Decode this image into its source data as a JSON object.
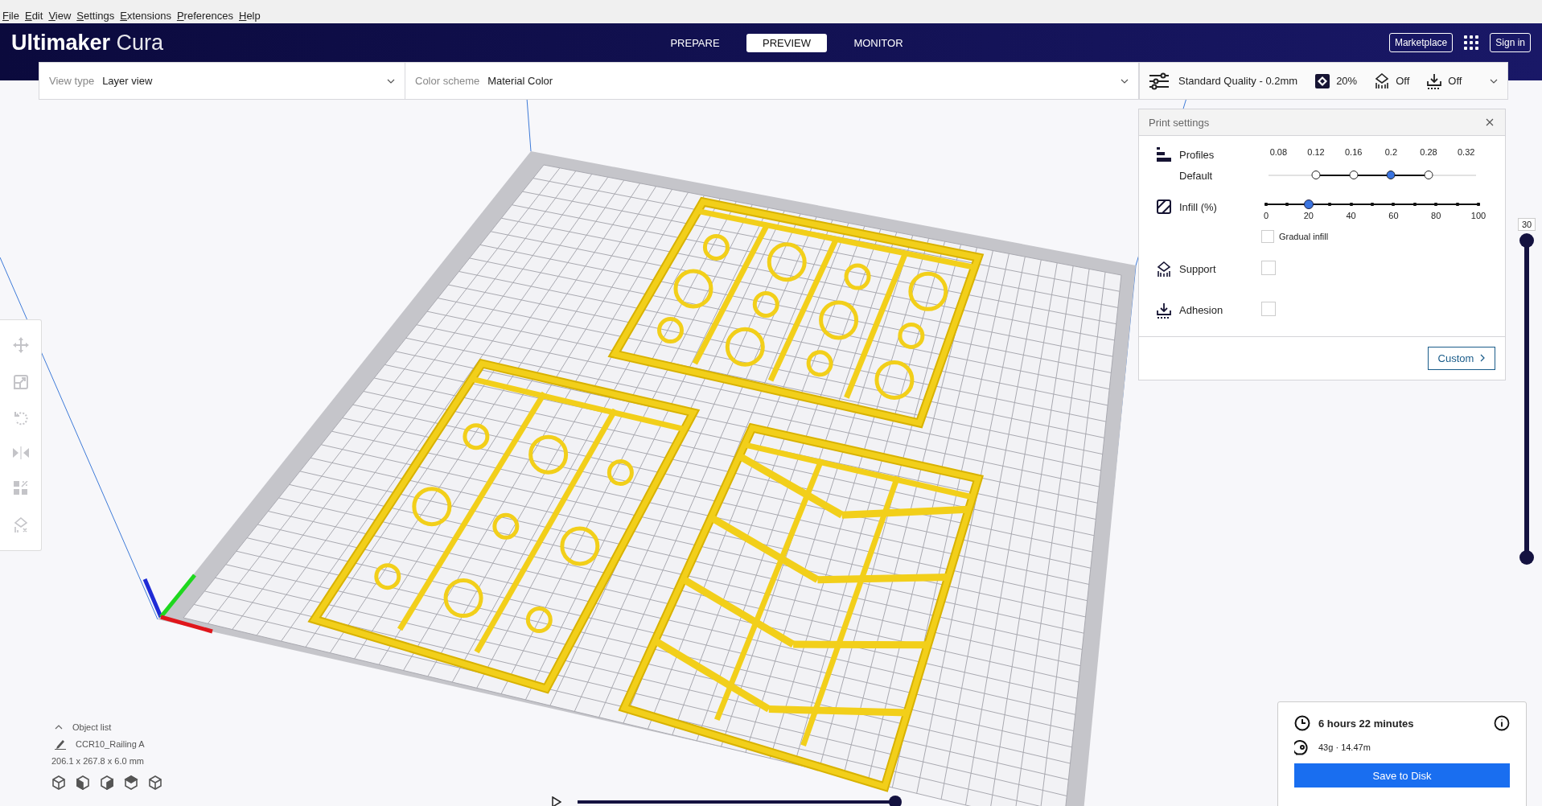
{
  "menu": [
    {
      "label": "File"
    },
    {
      "label": "Edit"
    },
    {
      "label": "View"
    },
    {
      "label": "Settings"
    },
    {
      "label": "Extensions"
    },
    {
      "label": "Preferences"
    },
    {
      "label": "Help"
    }
  ],
  "app_title": {
    "brand": "Ultimaker",
    "product": "Cura"
  },
  "stage_tabs": [
    {
      "label": "PREPARE",
      "selected": false
    },
    {
      "label": "PREVIEW",
      "selected": true
    },
    {
      "label": "MONITOR",
      "selected": false
    }
  ],
  "header_buttons": {
    "marketplace": "Marketplace",
    "sign_in": "Sign in"
  },
  "view_type": {
    "label": "View type",
    "value": "Layer view"
  },
  "color_scheme": {
    "label": "Color scheme",
    "value": "Material Color"
  },
  "print_summary": {
    "profile": "Standard Quality - 0.2mm",
    "infill": "20%",
    "support": "Off",
    "adhesion": "Off"
  },
  "print_settings": {
    "title": "Print settings",
    "profiles": {
      "label": "Profiles",
      "sublabel": "Default",
      "layer_heights": [
        {
          "label": "0.08",
          "available": false,
          "selected": false
        },
        {
          "label": "0.12",
          "available": true,
          "selected": false
        },
        {
          "label": "0.16",
          "available": true,
          "selected": false
        },
        {
          "label": "0.2",
          "available": true,
          "selected": true
        },
        {
          "label": "0.28",
          "available": true,
          "selected": false
        },
        {
          "label": "0.32",
          "available": false,
          "selected": false
        }
      ]
    },
    "infill": {
      "label": "Infill (%)",
      "level": 0.2,
      "ticks": [
        "0",
        "20",
        "40",
        "60",
        "80",
        "100"
      ],
      "gradual": {
        "label": "Gradual infill",
        "checked": false
      }
    },
    "support": {
      "label": "Support",
      "checked": false
    },
    "adhesion": {
      "label": "Adhesion",
      "checked": false
    },
    "custom_button": "Custom"
  },
  "layer_slider": {
    "value": "30",
    "level": 1
  },
  "object_list": {
    "label": "Object list",
    "item": "CCR10_Railing A",
    "dimensions": "206.1 x 267.8 x 6.0 mm"
  },
  "print_info": {
    "time": "6 hours 22 minutes",
    "material": "43g · 14.47m",
    "button": "Save to Disk"
  },
  "playback": {
    "level": 1
  }
}
